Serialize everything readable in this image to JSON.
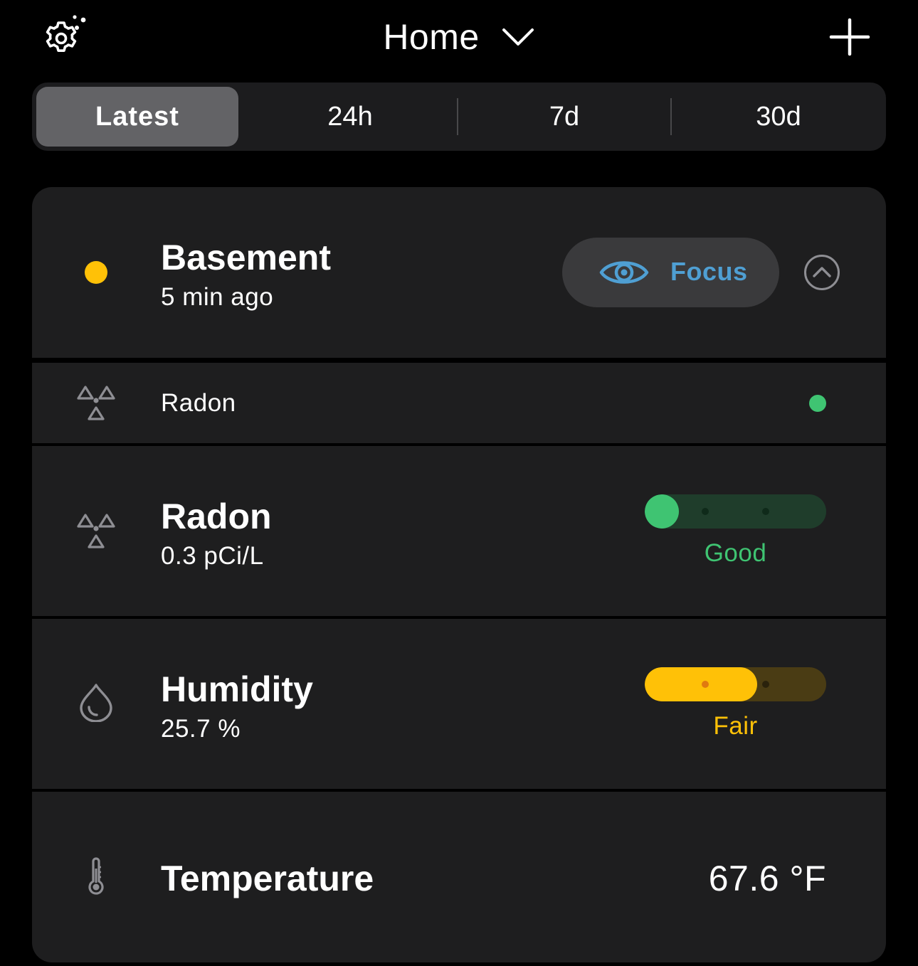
{
  "header": {
    "settings_icon": "settings-gear-icon",
    "location": "Home",
    "chevron_icon": "chevron-down-icon",
    "add_icon": "plus-icon"
  },
  "tabs": [
    {
      "label": "Latest",
      "active": true
    },
    {
      "label": "24h",
      "active": false
    },
    {
      "label": "7d",
      "active": false
    },
    {
      "label": "30d",
      "active": false
    }
  ],
  "device": {
    "name": "Basement",
    "last_updated": "5 min ago",
    "status_color": "#ffc107",
    "focus_label": "Focus",
    "focus_icon": "eye-icon",
    "collapse_icon": "chevron-up-icon"
  },
  "summary": {
    "label": "Radon",
    "icon": "radiation-icon",
    "status_color": "#3fc472"
  },
  "metrics": [
    {
      "name": "Radon",
      "value": "0.3 pCi/L",
      "icon": "radiation-icon",
      "rating": "Good",
      "rating_color": "#3fc472",
      "level": 0.19
    },
    {
      "name": "Humidity",
      "value": "25.7 %",
      "icon": "water-drop-icon",
      "rating": "Fair",
      "rating_color": "#ffc107",
      "level": 0.62
    }
  ],
  "temperature": {
    "name": "Temperature",
    "value": "67.6 °F",
    "icon": "thermometer-icon"
  },
  "colors": {
    "background": "#000000",
    "card": "#1e1e1f",
    "focus_text": "#4f9fd3",
    "good": "#3fc472",
    "fair": "#ffc107",
    "icon_gray": "#8e8e93"
  }
}
